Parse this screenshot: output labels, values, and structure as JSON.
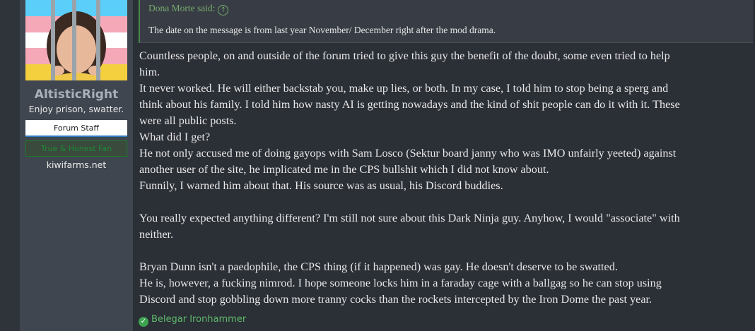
{
  "user": {
    "name": "AltisticRight",
    "title": "Enjoy prison, swatter.",
    "banner_staff": "Forum Staff",
    "banner_fan": "True & Honest Fan",
    "site": "kiwifarms.net"
  },
  "quote": {
    "attribution": "Dona Morte said:",
    "text": "The date on the message is from last year November/ December right after the mod drama."
  },
  "message": {
    "lines": [
      "Countless people, on and outside of the forum tried to give this guy the benefit of the doubt, some even tried to help",
      "him.",
      "It never worked. He will either backstab you, make up lies, or both. In my case, I told him to stop being a sperg and",
      "think about his family. I told him how nasty AI is getting nowadays and the kind of shit people can do it with it. These",
      "were all public posts.",
      "What did I get?",
      "He not only accused me of doing gayops with Sam Losco (Sektur board janny who was IMO unfairly yeeted) against",
      "another user of the site, he implicated me in the CPS bullshit which I did not know about.",
      "Funnily, I warned him about that. His source was as usual, his Discord buddies.",
      "",
      "You really expected anything different? I'm still not sure about this Dark Ninja guy. Anyhow, I would \"associate\" with",
      "neither.",
      "",
      "Bryan Dunn isn't a paedophile, the CPS thing (if it happened) was gay. He doesn't deserve to be swatted.",
      "He is, however, a fucking nimrod. I hope someone locks him in a faraday cage with a ballgag so he can stop using",
      "Discord and stop gobbling down more tranny cocks than the rockets intercepted by the Iron Dome the past year."
    ]
  },
  "reactions": {
    "user": "Belegar Ironhammer"
  }
}
